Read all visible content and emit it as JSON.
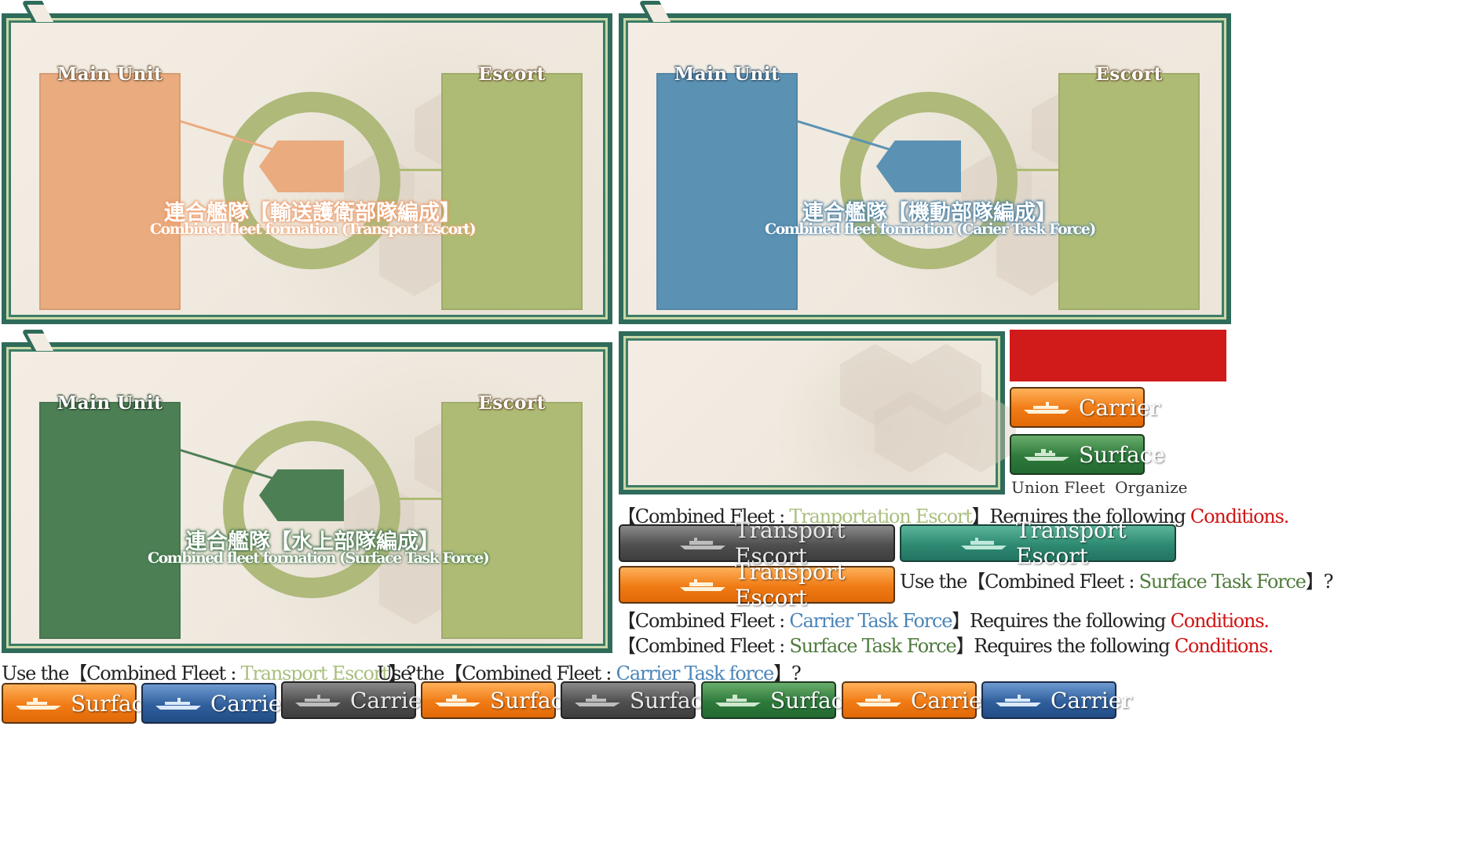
{
  "panels": [
    {
      "main_label": "Main Unit",
      "escort_label": "Escort",
      "title_jp": "連合艦隊【輸送護衛部隊編成】",
      "title_en": "Combined fleet formation (Transport Escort)",
      "main_color": "#eaab7f",
      "escort_color": "#aebb74",
      "title_color": "#f0a070"
    },
    {
      "main_label": "Main Unit",
      "escort_label": "Escort",
      "title_jp": "連合艦隊【機動部隊編成】",
      "title_en": "Combined fleet formation (Carier Task Force)",
      "main_color": "#5b92b3",
      "escort_color": "#aebb74",
      "title_color": "#5b92b3"
    },
    {
      "main_label": "Main Unit",
      "escort_label": "Escort",
      "title_jp": "連合艦隊【水上部隊編成】",
      "title_en": "Combined fleet formation (Surface Task Force)",
      "main_color": "#4d7f55",
      "escort_color": "#aebb74",
      "title_color": "#4d7f55"
    }
  ],
  "side_buttons": {
    "carrier": "Carrier",
    "surface": "Surface",
    "caption": "Union Fleet  Organize"
  },
  "messages": {
    "transport_req": {
      "prefix": "【Combined Fleet : ",
      "name": "Tranportation Escort",
      "suffix": "】Requires the following ",
      "cond": "Conditions."
    },
    "surface_use": {
      "prefix": "Use the【Combined Fleet : ",
      "name": "Surface Task Force",
      "suffix": "】?"
    },
    "carrier_req": {
      "prefix": "【Combined Fleet : ",
      "name": "Carrier Task Force",
      "suffix": "】Requires the following ",
      "cond": "Conditions."
    },
    "surface_req": {
      "prefix": "【Combined Fleet : ",
      "name": "Surface Task Force",
      "suffix": "】Requires the following ",
      "cond": "Conditions."
    },
    "transport_use": {
      "prefix": "Use the【Combined Fleet : ",
      "name": "Transport Escort",
      "suffix": "】?"
    },
    "carrier_use": {
      "prefix": "Use the【Combined Fleet : ",
      "name": "Carrier Task force",
      "suffix": "】?"
    }
  },
  "transport_buttons": [
    "Transport Escort",
    "Transport Escort",
    "Transport Escort"
  ],
  "bottom_buttons": [
    "Surface",
    "Carrier",
    "Carrier",
    "Surface",
    "Surface",
    "Surface",
    "Carrier",
    "Carrier"
  ],
  "colors": {
    "red_block": "#d11a1a",
    "frame": "#2f6b5a",
    "ring": "#aeb97a"
  }
}
